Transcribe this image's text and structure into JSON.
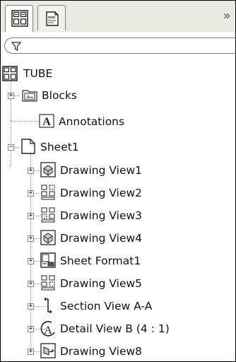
{
  "tree": {
    "root": {
      "label": "TUBE",
      "icon": "drawing-icon"
    },
    "blocks": {
      "label": "Blocks",
      "expand": "+",
      "icon": "blocks-folder-icon"
    },
    "annotations": {
      "label": "Annotations",
      "icon": "annotation-icon"
    },
    "sheet": {
      "label": "Sheet1",
      "expand": "−",
      "icon": "sheet-icon"
    },
    "items": [
      {
        "label": "Drawing View1",
        "expand": "+",
        "icon": "isometric-view-icon"
      },
      {
        "label": "Drawing View2",
        "expand": "+",
        "icon": "standard-view-icon"
      },
      {
        "label": "Drawing View3",
        "expand": "+",
        "icon": "standard-view-icon"
      },
      {
        "label": "Drawing View4",
        "expand": "+",
        "icon": "isometric-view-icon"
      },
      {
        "label": "Sheet Format1",
        "expand": "+",
        "icon": "sheet-format-icon"
      },
      {
        "label": "Drawing View5",
        "expand": "+",
        "icon": "standard-view-icon"
      },
      {
        "label": "Section View A-A",
        "expand": "+",
        "icon": "section-view-icon"
      },
      {
        "label": "Detail View B (4 : 1)",
        "expand": "+",
        "icon": "detail-view-icon"
      },
      {
        "label": "Drawing View8",
        "expand": "+",
        "icon": "auxiliary-view-icon"
      }
    ]
  },
  "tabs": [
    {
      "icon": "feature-manager-icon"
    },
    {
      "icon": "property-manager-icon"
    }
  ],
  "more_label": "»"
}
